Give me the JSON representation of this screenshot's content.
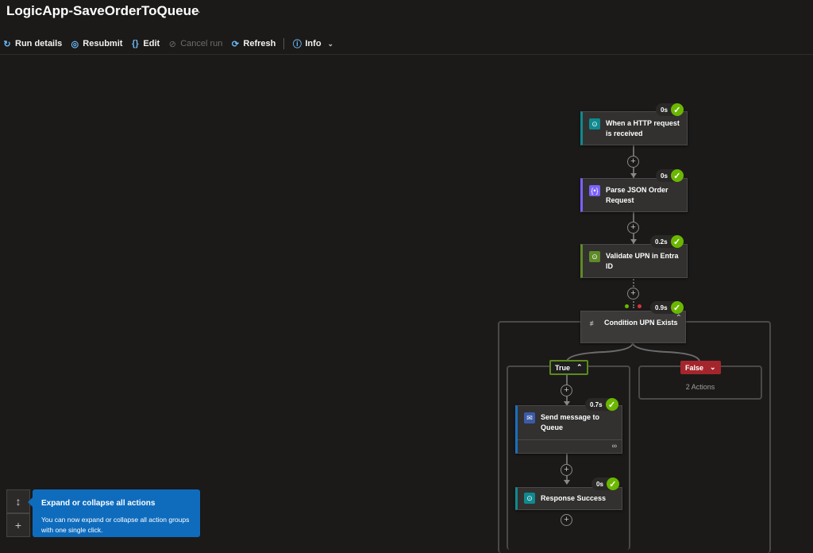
{
  "app": {
    "title": "LogicApp-SaveOrderToQueue",
    "more_label": "···"
  },
  "toolbar": {
    "run_details": "Run details",
    "resubmit": "Resubmit",
    "edit": "Edit",
    "cancel_run": "Cancel run",
    "refresh": "Refresh",
    "info": "Info"
  },
  "workflow": {
    "trigger": {
      "label": "When a HTTP request is received",
      "duration": "0s"
    },
    "parse": {
      "label": "Parse JSON Order Request",
      "duration": "0s"
    },
    "validate": {
      "label": "Validate UPN in Entra ID",
      "duration": "0.2s"
    },
    "condition": {
      "label": "Condition UPN Exists",
      "duration": "0.9s"
    },
    "true_branch": {
      "label": "True"
    },
    "false_branch": {
      "label": "False",
      "summary": "2 Actions"
    },
    "send_message": {
      "label": "Send message to Queue",
      "duration": "0.7s"
    },
    "response": {
      "label": "Response Success",
      "duration": "0s"
    }
  },
  "teaching_tip": {
    "title": "Expand or collapse all actions",
    "body": "You can now expand or collapse all action groups with one single click."
  },
  "colors": {
    "accent": "#0f6cbd",
    "success": "#6bb700",
    "false_red": "#a4262c",
    "true_green": "#5c8a1b"
  }
}
